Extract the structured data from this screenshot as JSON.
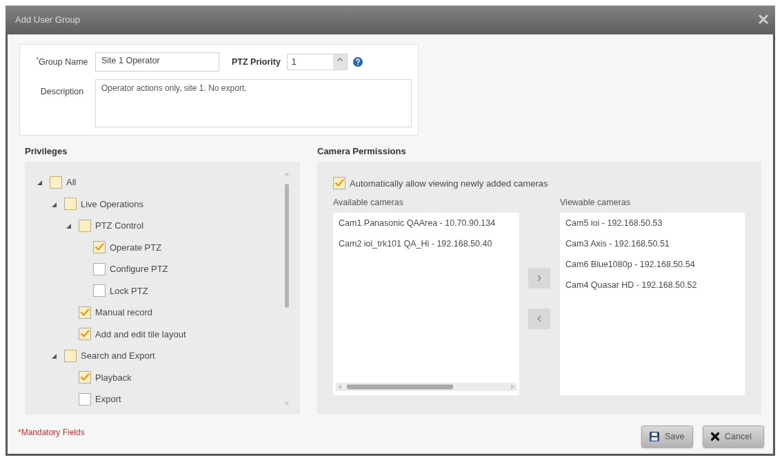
{
  "window": {
    "title": "Add User Group"
  },
  "general": {
    "group_name": {
      "required_mark": "*",
      "label": "Group Name",
      "value": "Site 1 Operator"
    },
    "ptz_priority": {
      "label": "PTZ Priority",
      "value": "1"
    },
    "description": {
      "label": "Description",
      "value": "Operator actions only, site 1. No export."
    }
  },
  "privileges": {
    "title": "Privileges",
    "tree": [
      {
        "label": "All",
        "checked": false,
        "partial": true,
        "expanded": true,
        "children": [
          {
            "label": "Live Operations",
            "checked": false,
            "partial": true,
            "expanded": true,
            "children": [
              {
                "label": "PTZ Control",
                "checked": false,
                "partial": true,
                "expanded": true,
                "children": [
                  {
                    "label": "Operate PTZ",
                    "checked": true,
                    "partial": false
                  },
                  {
                    "label": "Configure PTZ",
                    "checked": false,
                    "partial": false
                  },
                  {
                    "label": "Lock PTZ",
                    "checked": false,
                    "partial": false
                  }
                ]
              },
              {
                "label": "Manual record",
                "checked": true,
                "partial": false
              },
              {
                "label": "Add and edit tile layout",
                "checked": true,
                "partial": false
              }
            ]
          },
          {
            "label": "Search and Export",
            "checked": false,
            "partial": true,
            "expanded": true,
            "children": [
              {
                "label": "Playback",
                "checked": true,
                "partial": false
              },
              {
                "label": "Export",
                "checked": false,
                "partial": false
              }
            ]
          }
        ]
      }
    ]
  },
  "camera_permissions": {
    "title": "Camera Permissions",
    "auto_allow": {
      "label": "Automatically allow viewing newly added cameras",
      "checked": true
    },
    "available_cameras": {
      "title": "Available cameras",
      "items": [
        {
          "label": "Cam1 Panasonic QAArea - 10.70.90.134",
          "selected": false
        },
        {
          "label": "Cam2 ioi_trk101 QA_Hi - 192.168.50.40",
          "selected": false
        }
      ]
    },
    "viewable_cameras": {
      "title": "Viewable cameras",
      "items": [
        {
          "label": "Cam5 ioi - 192.168.50.53",
          "selected": false
        },
        {
          "label": "Cam3 Axis - 192.168.50.51",
          "selected": false
        },
        {
          "label": "Cam6 Blue1080p - 192.168.50.54",
          "selected": false
        },
        {
          "label": "Cam4 Quasar HD - 192.168.50.52",
          "selected": false
        }
      ]
    }
  },
  "footer": {
    "note": "*Mandatory Fields",
    "buttons": [
      {
        "label": "Save",
        "kind": "save"
      },
      {
        "label": "Cancel",
        "kind": "cancel"
      }
    ]
  }
}
